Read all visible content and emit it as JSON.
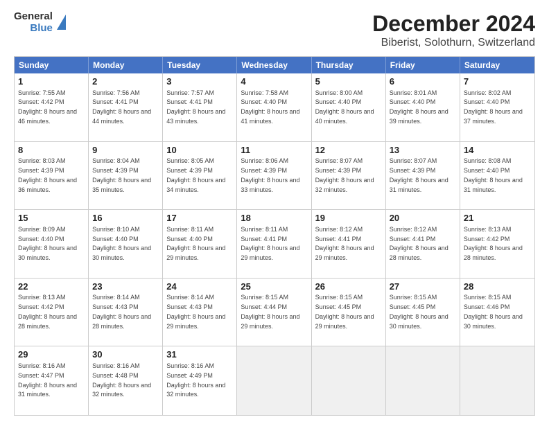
{
  "header": {
    "logo_line1": "General",
    "logo_line2": "Blue",
    "title": "December 2024",
    "subtitle": "Biberist, Solothurn, Switzerland"
  },
  "weekdays": [
    "Sunday",
    "Monday",
    "Tuesday",
    "Wednesday",
    "Thursday",
    "Friday",
    "Saturday"
  ],
  "weeks": [
    [
      {
        "num": "1",
        "sunrise": "7:55 AM",
        "sunset": "4:42 PM",
        "daylight": "8 hours and 46 minutes."
      },
      {
        "num": "2",
        "sunrise": "7:56 AM",
        "sunset": "4:41 PM",
        "daylight": "8 hours and 44 minutes."
      },
      {
        "num": "3",
        "sunrise": "7:57 AM",
        "sunset": "4:41 PM",
        "daylight": "8 hours and 43 minutes."
      },
      {
        "num": "4",
        "sunrise": "7:58 AM",
        "sunset": "4:40 PM",
        "daylight": "8 hours and 41 minutes."
      },
      {
        "num": "5",
        "sunrise": "8:00 AM",
        "sunset": "4:40 PM",
        "daylight": "8 hours and 40 minutes."
      },
      {
        "num": "6",
        "sunrise": "8:01 AM",
        "sunset": "4:40 PM",
        "daylight": "8 hours and 39 minutes."
      },
      {
        "num": "7",
        "sunrise": "8:02 AM",
        "sunset": "4:40 PM",
        "daylight": "8 hours and 37 minutes."
      }
    ],
    [
      {
        "num": "8",
        "sunrise": "8:03 AM",
        "sunset": "4:39 PM",
        "daylight": "8 hours and 36 minutes."
      },
      {
        "num": "9",
        "sunrise": "8:04 AM",
        "sunset": "4:39 PM",
        "daylight": "8 hours and 35 minutes."
      },
      {
        "num": "10",
        "sunrise": "8:05 AM",
        "sunset": "4:39 PM",
        "daylight": "8 hours and 34 minutes."
      },
      {
        "num": "11",
        "sunrise": "8:06 AM",
        "sunset": "4:39 PM",
        "daylight": "8 hours and 33 minutes."
      },
      {
        "num": "12",
        "sunrise": "8:07 AM",
        "sunset": "4:39 PM",
        "daylight": "8 hours and 32 minutes."
      },
      {
        "num": "13",
        "sunrise": "8:07 AM",
        "sunset": "4:39 PM",
        "daylight": "8 hours and 31 minutes."
      },
      {
        "num": "14",
        "sunrise": "8:08 AM",
        "sunset": "4:40 PM",
        "daylight": "8 hours and 31 minutes."
      }
    ],
    [
      {
        "num": "15",
        "sunrise": "8:09 AM",
        "sunset": "4:40 PM",
        "daylight": "8 hours and 30 minutes."
      },
      {
        "num": "16",
        "sunrise": "8:10 AM",
        "sunset": "4:40 PM",
        "daylight": "8 hours and 30 minutes."
      },
      {
        "num": "17",
        "sunrise": "8:11 AM",
        "sunset": "4:40 PM",
        "daylight": "8 hours and 29 minutes."
      },
      {
        "num": "18",
        "sunrise": "8:11 AM",
        "sunset": "4:41 PM",
        "daylight": "8 hours and 29 minutes."
      },
      {
        "num": "19",
        "sunrise": "8:12 AM",
        "sunset": "4:41 PM",
        "daylight": "8 hours and 29 minutes."
      },
      {
        "num": "20",
        "sunrise": "8:12 AM",
        "sunset": "4:41 PM",
        "daylight": "8 hours and 28 minutes."
      },
      {
        "num": "21",
        "sunrise": "8:13 AM",
        "sunset": "4:42 PM",
        "daylight": "8 hours and 28 minutes."
      }
    ],
    [
      {
        "num": "22",
        "sunrise": "8:13 AM",
        "sunset": "4:42 PM",
        "daylight": "8 hours and 28 minutes."
      },
      {
        "num": "23",
        "sunrise": "8:14 AM",
        "sunset": "4:43 PM",
        "daylight": "8 hours and 28 minutes."
      },
      {
        "num": "24",
        "sunrise": "8:14 AM",
        "sunset": "4:43 PM",
        "daylight": "8 hours and 29 minutes."
      },
      {
        "num": "25",
        "sunrise": "8:15 AM",
        "sunset": "4:44 PM",
        "daylight": "8 hours and 29 minutes."
      },
      {
        "num": "26",
        "sunrise": "8:15 AM",
        "sunset": "4:45 PM",
        "daylight": "8 hours and 29 minutes."
      },
      {
        "num": "27",
        "sunrise": "8:15 AM",
        "sunset": "4:45 PM",
        "daylight": "8 hours and 30 minutes."
      },
      {
        "num": "28",
        "sunrise": "8:15 AM",
        "sunset": "4:46 PM",
        "daylight": "8 hours and 30 minutes."
      }
    ],
    [
      {
        "num": "29",
        "sunrise": "8:16 AM",
        "sunset": "4:47 PM",
        "daylight": "8 hours and 31 minutes."
      },
      {
        "num": "30",
        "sunrise": "8:16 AM",
        "sunset": "4:48 PM",
        "daylight": "8 hours and 32 minutes."
      },
      {
        "num": "31",
        "sunrise": "8:16 AM",
        "sunset": "4:49 PM",
        "daylight": "8 hours and 32 minutes."
      },
      null,
      null,
      null,
      null
    ]
  ]
}
